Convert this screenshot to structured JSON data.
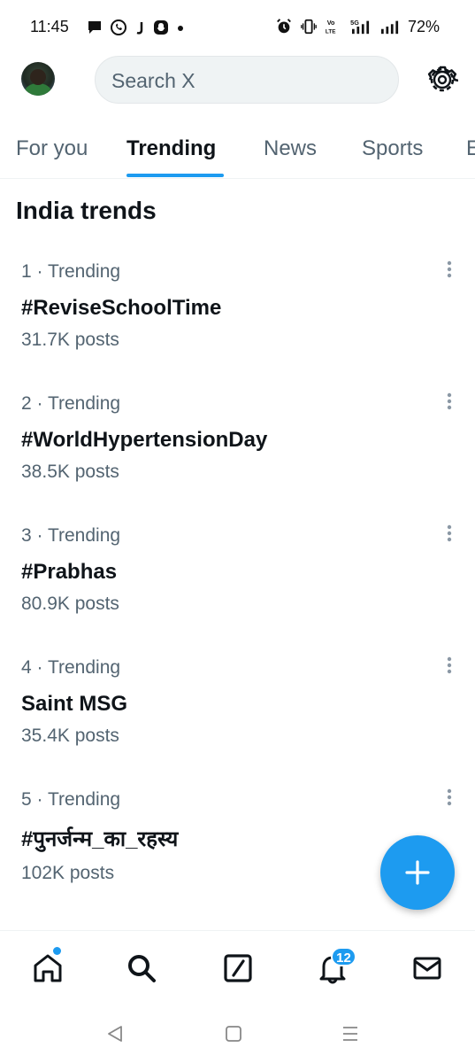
{
  "status_bar": {
    "time": "11:45",
    "battery": "72%",
    "left_icons": [
      "message-icon",
      "whatsapp-icon",
      "j-app-icon",
      "snapchat-icon",
      "dot-icon"
    ],
    "right_icons": [
      "alarm-icon",
      "vibrate-icon",
      "volte-icon",
      "5g-signal-icon",
      "signal-icon"
    ]
  },
  "header": {
    "search_placeholder": "Search X"
  },
  "tabs": [
    {
      "label": "For you",
      "active": false
    },
    {
      "label": "Trending",
      "active": true
    },
    {
      "label": "News",
      "active": false
    },
    {
      "label": "Sports",
      "active": false
    },
    {
      "label": "E",
      "active": false
    }
  ],
  "section_title": "India trends",
  "trends": [
    {
      "meta": "1 · Trending",
      "name": "#ReviseSchoolTime",
      "count": "31.7K posts"
    },
    {
      "meta": "2 · Trending",
      "name": "#WorldHypertensionDay",
      "count": "38.5K posts"
    },
    {
      "meta": "3 · Trending",
      "name": "#Prabhas",
      "count": "80.9K posts"
    },
    {
      "meta": "4 · Trending",
      "name": "Saint MSG",
      "count": "35.4K posts"
    },
    {
      "meta": "5 · Trending",
      "name": "#पुनर्जन्म_का_रहस्य",
      "count": "102K posts"
    }
  ],
  "bottom_nav": {
    "notification_count": "12",
    "items": [
      "home-icon",
      "search-icon",
      "grok-icon",
      "bell-icon",
      "mail-icon"
    ]
  },
  "colors": {
    "accent": "#1d9bf0",
    "text_primary": "#0f1419",
    "text_secondary": "#536471"
  }
}
